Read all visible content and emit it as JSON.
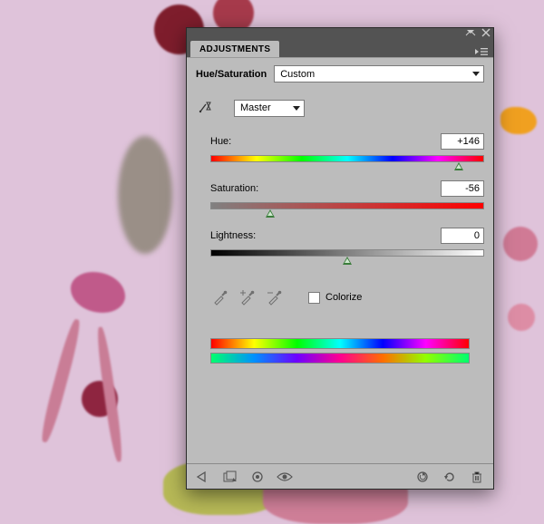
{
  "panel": {
    "tab_label": "ADJUSTMENTS",
    "title": "Hue/Saturation",
    "preset_selected": "Custom",
    "channel_selected": "Master",
    "colorize_label": "Colorize",
    "colorize_checked": false
  },
  "sliders": {
    "hue": {
      "label": "Hue:",
      "value": "+146",
      "min": -180,
      "max": 180,
      "pos_pct": 90.6
    },
    "saturation": {
      "label": "Saturation:",
      "value": "-56",
      "min": -100,
      "max": 100,
      "pos_pct": 22.0
    },
    "lightness": {
      "label": "Lightness:",
      "value": "0",
      "min": -100,
      "max": 100,
      "pos_pct": 50.0
    }
  },
  "icons": {
    "collapse": "collapse-icon",
    "close": "close-icon",
    "menu": "panel-menu-icon",
    "targeted": "targeted-adjustment-icon",
    "eyedropper": "eyedropper-icon",
    "eyedropper_plus": "eyedropper-plus-icon",
    "eyedropper_minus": "eyedropper-minus-icon",
    "back": "back-icon",
    "adjustment_presets": "adjustment-presets-icon",
    "clip_mask": "clip-to-layer-icon",
    "visibility": "visibility-icon",
    "previous_state": "previous-state-icon",
    "reset": "reset-icon",
    "trash": "trash-icon"
  }
}
